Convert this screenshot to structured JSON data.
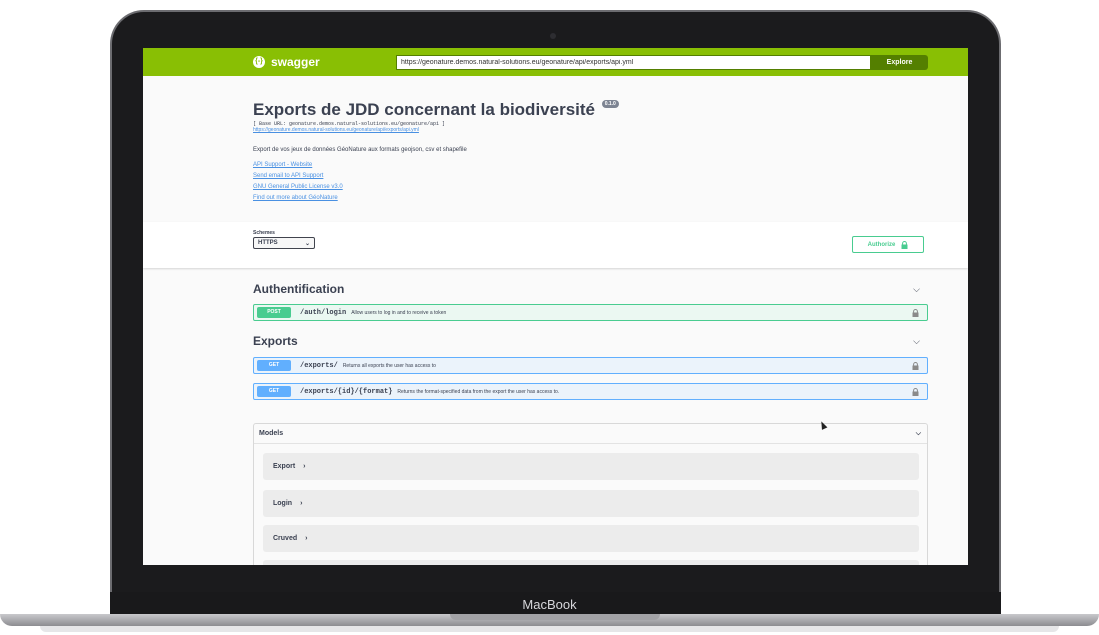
{
  "device": {
    "brand": "MacBook"
  },
  "topbar": {
    "logo_text": "swagger",
    "logo_icon": "{-}",
    "url_value": "https://geonature.demos.natural-solutions.eu/geonature/api/exports/api.yml",
    "explore_label": "Explore"
  },
  "info": {
    "title": "Exports de JDD concernant la biodiversité",
    "version": "0.1.0",
    "base_url": "[ Base URL: geonature.demos.natural-solutions.eu/geonature/api ]",
    "spec_link": "https://geonature.demos.natural-solutions.eu/geonature/api/exports/api.yml",
    "description": "Export de vos jeux de données GéoNature aux formats geojson, csv et shapefile",
    "links": [
      "API Support - Website",
      "Send email to API Support",
      "GNU General Public License v3.0",
      "Find out more about GéoNature"
    ]
  },
  "schemes": {
    "label": "Schemes",
    "selected": "HTTPS",
    "authorize_label": "Authorize"
  },
  "tags": [
    {
      "name": "Authentification",
      "operations": [
        {
          "method": "POST",
          "path": "/auth/login",
          "summary": "Allow users to log in and to receive a token"
        }
      ]
    },
    {
      "name": "Exports",
      "operations": [
        {
          "method": "GET",
          "path": "/exports/",
          "summary": "Returns all exports the user has access to"
        },
        {
          "method": "GET",
          "path": "/exports/{id}/{format}",
          "summary": "Returns the format-specified data from the export the user has access to."
        }
      ]
    }
  ],
  "models": {
    "title": "Models",
    "items": [
      "Export",
      "Login",
      "Cruved"
    ]
  },
  "icons": {
    "chevron_down": "⌵",
    "chevron_right": "›",
    "lock": "🔒",
    "select_arrow": "⌄"
  },
  "colors": {
    "topbar": "#89bf04",
    "post": "#49cc90",
    "get": "#61affe",
    "text": "#3b4151"
  }
}
